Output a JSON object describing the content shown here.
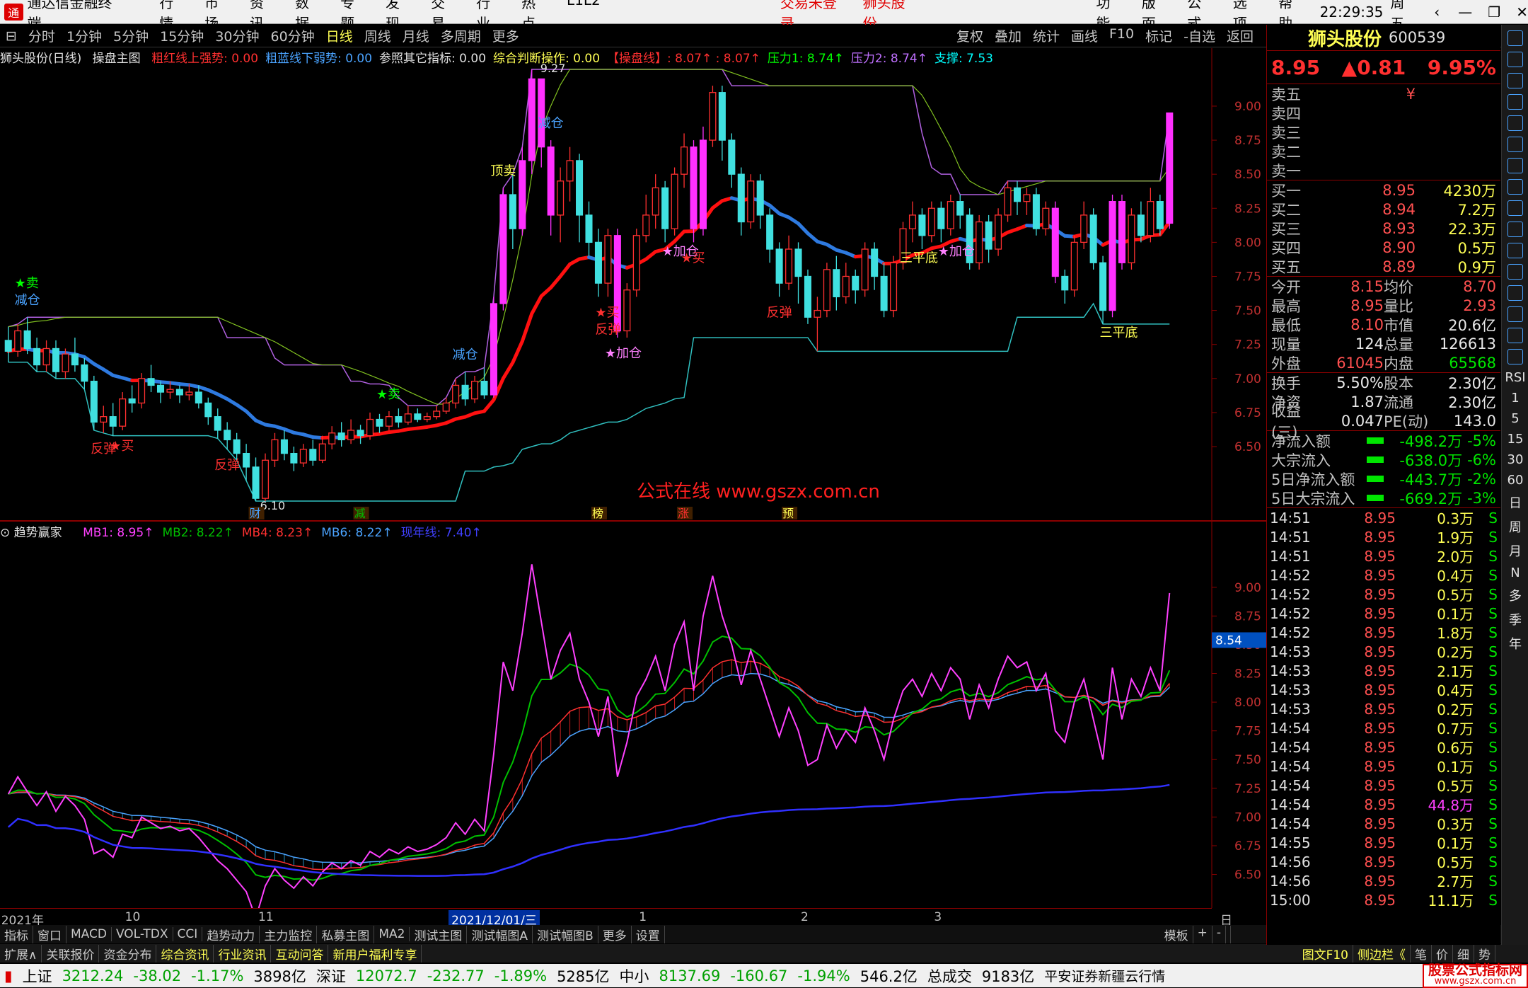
{
  "menubar": {
    "app_title": "通达信金融终端",
    "items": [
      "行情",
      "市场",
      "资讯",
      "数据",
      "专题",
      "发现",
      "交易",
      "行业",
      "热点",
      "L1L2"
    ],
    "login_status": "交易未登录",
    "stock_title": "狮头股份",
    "right_items": [
      "功能",
      "版面",
      "公式",
      "选项",
      "帮助"
    ],
    "time": "22:29:35",
    "weekday": "周五"
  },
  "toolbar": {
    "periods": [
      "分时",
      "1分钟",
      "5分钟",
      "15分钟",
      "30分钟",
      "60分钟",
      "日线",
      "周线",
      "月线",
      "多周期",
      "更多"
    ],
    "active_period": "日线",
    "right_tools": [
      "复权",
      "叠加",
      "统计",
      "画线",
      "F10",
      "标记",
      "-自选",
      "返回"
    ]
  },
  "upper_indicator": {
    "chart_label": "狮头股份(日线)",
    "main_name": "操盘主图",
    "items": [
      {
        "text": "粗红线上强势: 0.00",
        "color": "#ff3030"
      },
      {
        "text": "粗蓝线下弱势: 0.00",
        "color": "#4aa3ff"
      },
      {
        "text": "参照其它指标: 0.00",
        "color": "#e0e0e0"
      },
      {
        "text": "综合判断操作: 0.00",
        "color": "#ffff54"
      },
      {
        "text": "【操盘线】: 8.07↑ : 8.07↑",
        "color": "#ff3030"
      },
      {
        "text": "压力1: 8.74↑",
        "color": "#00ff00"
      },
      {
        "text": "压力2: 8.74↑",
        "color": "#c070ff"
      },
      {
        "text": "支撑: 7.53",
        "color": "#00ffff"
      }
    ]
  },
  "lower_indicator": {
    "name": "趋势赢家",
    "items": [
      {
        "text": "MB1: 8.95↑",
        "color": "#ff40ff"
      },
      {
        "text": "MB2: 8.22↑",
        "color": "#00c000"
      },
      {
        "text": "MB4: 8.23↑",
        "color": "#ff3030"
      },
      {
        "text": "MB6: 8.22↑",
        "color": "#4aa3ff"
      },
      {
        "text": "现年线: 7.40↑",
        "color": "#4040ff"
      }
    ],
    "current_value_tag": "8.54"
  },
  "upper_y_ticks": [
    "9.00",
    "8.75",
    "8.50",
    "8.25",
    "8.00",
    "7.75",
    "7.50",
    "7.25",
    "7.00",
    "6.75",
    "6.50"
  ],
  "lower_y_ticks": [
    "9.00",
    "8.75",
    "8.50",
    "8.25",
    "8.00",
    "7.75",
    "7.50",
    "7.25",
    "7.00",
    "6.75",
    "6.50"
  ],
  "chart_labels": {
    "high_price": "9.27",
    "low_price": "6.10",
    "watermark": "公式在线 www.gszx.com.cn",
    "signals": [
      {
        "text": "减仓",
        "color": "#4aa3ff",
        "i": 2
      },
      {
        "text": "★卖",
        "color": "#00ff00",
        "i": 2
      },
      {
        "text": "反弹",
        "color": "#ff3030",
        "i": 10
      },
      {
        "text": "★买",
        "color": "#ff3030",
        "i": 12
      },
      {
        "text": "反弹",
        "color": "#ff3030",
        "i": 23
      },
      {
        "text": "★卖",
        "color": "#00ff00",
        "i": 40
      },
      {
        "text": "减仓",
        "color": "#4aa3ff",
        "i": 48
      },
      {
        "text": "顶卖",
        "color": "#ffff54",
        "i": 52
      },
      {
        "text": "减仓",
        "color": "#4aa3ff",
        "i": 57
      },
      {
        "text": "★买",
        "color": "#ff3030",
        "i": 63
      },
      {
        "text": "反弹",
        "color": "#ff3030",
        "i": 63
      },
      {
        "text": "★加仓",
        "color": "#ff80ff",
        "i": 64
      },
      {
        "text": "★加仓",
        "color": "#ff80ff",
        "i": 70
      },
      {
        "text": "★买",
        "color": "#ff3030",
        "i": 72
      },
      {
        "text": "反弹",
        "color": "#ff3030",
        "i": 81
      },
      {
        "text": "三平底",
        "color": "#ffff54",
        "i": 95
      },
      {
        "text": "★加仓",
        "color": "#ff80ff",
        "i": 99
      },
      {
        "text": "三平底",
        "color": "#ffff54",
        "i": 116
      }
    ],
    "event_tags": [
      {
        "text": "财",
        "color": "#4aa3ff",
        "i": 26
      },
      {
        "text": "减",
        "color": "#00c000",
        "i": 37
      },
      {
        "text": "榜",
        "color": "#ffff54",
        "i": 62
      },
      {
        "text": "涨",
        "color": "#ff3030",
        "i": 71
      },
      {
        "text": "预",
        "color": "#ffff54",
        "i": 82
      }
    ]
  },
  "date_axis": {
    "labels": [
      {
        "text": "2021年",
        "i": 0
      },
      {
        "text": "10",
        "i": 13
      },
      {
        "text": "11",
        "i": 27
      },
      {
        "text": "2021/12/01/三",
        "i": 47
      },
      {
        "text": "1",
        "i": 67
      },
      {
        "text": "2",
        "i": 84
      },
      {
        "text": "3",
        "i": 98
      }
    ],
    "period_label": "日线"
  },
  "bottom_tabs": [
    "指标",
    "窗口",
    "MACD",
    "VOL-TDX",
    "CCI",
    "趋势动力",
    "主力监控",
    "私募主图",
    "MA2",
    "测试主图",
    "测试幅图A",
    "测试幅图B",
    "更多",
    "设置"
  ],
  "bottom_right": [
    "模板",
    "+",
    "-"
  ],
  "ext_bar": {
    "items": [
      "扩展∧",
      "关联报价",
      "资金分布",
      "综合资讯",
      "行业资讯",
      "互动问答",
      "新用户福利专享"
    ],
    "highlight": [
      "综合资讯",
      "行业资讯",
      "互动问答",
      "新用户福利专享"
    ],
    "right_items": [
      "图文F10",
      "侧边栏《",
      "笔",
      "价",
      "细",
      "势"
    ]
  },
  "status_bar": {
    "items": [
      {
        "name": "上证",
        "value": "3212.24",
        "change": "-38.02",
        "pct": "-1.17%",
        "amount": "3898亿"
      },
      {
        "name": "深证",
        "value": "12072.7",
        "change": "-232.77",
        "pct": "-1.89%",
        "amount": "5285亿"
      },
      {
        "name": "中小",
        "value": "8137.69",
        "change": "-160.67",
        "pct": "-1.94%",
        "amount": "546.2亿"
      }
    ],
    "total_label": "总成交",
    "total_value": "9183亿",
    "broker": "平安证券新疆云行情",
    "brand": "股票公式指标网",
    "brand_url": "www.gszx.com.cn"
  },
  "quote_panel": {
    "name": "狮头股份",
    "code": "600539",
    "price": "8.95",
    "change": "▲0.81",
    "pct": "9.95%",
    "sells": [
      {
        "label": "卖五",
        "price": "¥",
        "vol": ""
      },
      {
        "label": "卖四",
        "price": "",
        "vol": ""
      },
      {
        "label": "卖三",
        "price": "",
        "vol": ""
      },
      {
        "label": "卖二",
        "price": "",
        "vol": ""
      },
      {
        "label": "卖一",
        "price": "",
        "vol": ""
      }
    ],
    "buys": [
      {
        "label": "买一",
        "price": "8.95",
        "vol": "4230万"
      },
      {
        "label": "买二",
        "price": "8.94",
        "vol": "7.2万"
      },
      {
        "label": "买三",
        "price": "8.93",
        "vol": "22.3万"
      },
      {
        "label": "买四",
        "price": "8.90",
        "vol": "0.5万"
      },
      {
        "label": "买五",
        "price": "8.89",
        "vol": "0.9万"
      }
    ],
    "stats": [
      [
        {
          "k": "今开",
          "v": "8.15",
          "c": "r"
        },
        {
          "k": "均价",
          "v": "8.70",
          "c": "r"
        }
      ],
      [
        {
          "k": "最高",
          "v": "8.95",
          "c": "r"
        },
        {
          "k": "量比",
          "v": "2.93",
          "c": "r"
        }
      ],
      [
        {
          "k": "最低",
          "v": "8.10",
          "c": "r"
        },
        {
          "k": "市值",
          "v": "20.6亿",
          "c": "w"
        }
      ],
      [
        {
          "k": "现量",
          "v": "124",
          "c": "w"
        },
        {
          "k": "总量",
          "v": "126613",
          "c": "w"
        }
      ],
      [
        {
          "k": "外盘",
          "v": "61045",
          "c": "r"
        },
        {
          "k": "内盘",
          "v": "65568",
          "c": "g"
        }
      ]
    ],
    "fin": [
      [
        {
          "k": "换手",
          "v": "5.50%",
          "c": "w"
        },
        {
          "k": "股本",
          "v": "2.30亿",
          "c": "w"
        }
      ],
      [
        {
          "k": "净资",
          "v": "1.87",
          "c": "w"
        },
        {
          "k": "流通",
          "v": "2.30亿",
          "c": "w"
        }
      ],
      [
        {
          "k": "收益(三)",
          "v": "0.047",
          "c": "w"
        },
        {
          "k": "PE(动)",
          "v": "143.0",
          "c": "w"
        }
      ]
    ],
    "flows": [
      {
        "k": "净流入额",
        "v": "-498.2万",
        "p": "-5%"
      },
      {
        "k": "大宗流入",
        "v": "-638.0万",
        "p": "-6%"
      },
      {
        "k": "5日净流入额",
        "v": "-443.7万",
        "p": "-2%"
      },
      {
        "k": "5日大宗流入",
        "v": "-669.2万",
        "p": "-3%"
      }
    ],
    "ticks": [
      {
        "t": "14:51",
        "p": "8.95",
        "v": "0.3万",
        "s": "S"
      },
      {
        "t": "14:51",
        "p": "8.95",
        "v": "1.9万",
        "s": "S"
      },
      {
        "t": "14:51",
        "p": "8.95",
        "v": "2.0万",
        "s": "S"
      },
      {
        "t": "14:52",
        "p": "8.95",
        "v": "0.4万",
        "s": "S"
      },
      {
        "t": "14:52",
        "p": "8.95",
        "v": "0.5万",
        "s": "S"
      },
      {
        "t": "14:52",
        "p": "8.95",
        "v": "0.1万",
        "s": "S"
      },
      {
        "t": "14:52",
        "p": "8.95",
        "v": "1.8万",
        "s": "S"
      },
      {
        "t": "14:53",
        "p": "8.95",
        "v": "0.2万",
        "s": "S"
      },
      {
        "t": "14:53",
        "p": "8.95",
        "v": "2.1万",
        "s": "S"
      },
      {
        "t": "14:53",
        "p": "8.95",
        "v": "0.4万",
        "s": "S"
      },
      {
        "t": "14:53",
        "p": "8.95",
        "v": "0.2万",
        "s": "S"
      },
      {
        "t": "14:54",
        "p": "8.95",
        "v": "0.7万",
        "s": "S"
      },
      {
        "t": "14:54",
        "p": "8.95",
        "v": "0.6万",
        "s": "S"
      },
      {
        "t": "14:54",
        "p": "8.95",
        "v": "0.1万",
        "s": "S"
      },
      {
        "t": "14:54",
        "p": "8.95",
        "v": "0.5万",
        "s": "S"
      },
      {
        "t": "14:54",
        "p": "8.95",
        "v": "44.8万",
        "s": "S",
        "big": true
      },
      {
        "t": "14:54",
        "p": "8.95",
        "v": "0.3万",
        "s": "S"
      },
      {
        "t": "14:55",
        "p": "8.95",
        "v": "0.1万",
        "s": "S"
      },
      {
        "t": "14:56",
        "p": "8.95",
        "v": "0.5万",
        "s": "S"
      },
      {
        "t": "14:56",
        "p": "8.95",
        "v": "2.7万",
        "s": "S"
      },
      {
        "t": "15:00",
        "p": "8.95",
        "v": "11.1万",
        "s": "S"
      }
    ]
  },
  "side_icons": {
    "text_items": [
      "RSI",
      "1",
      "5",
      "15",
      "30",
      "60",
      "日",
      "周",
      "月",
      "N",
      "多",
      "季",
      "年"
    ]
  },
  "chart_data": {
    "type": "candlestick",
    "candles": [
      [
        7.28,
        7.2,
        7.38,
        7.12
      ],
      [
        7.2,
        7.35,
        7.4,
        7.16
      ],
      [
        7.35,
        7.22,
        7.45,
        7.18
      ],
      [
        7.22,
        7.1,
        7.3,
        7.05
      ],
      [
        7.1,
        7.22,
        7.28,
        7.05
      ],
      [
        7.22,
        7.05,
        7.28,
        7.0
      ],
      [
        7.05,
        7.18,
        7.22,
        7.0
      ],
      [
        7.18,
        7.1,
        7.3,
        7.05
      ],
      [
        7.1,
        6.98,
        7.15,
        6.92
      ],
      [
        6.98,
        6.68,
        7.02,
        6.62
      ],
      [
        6.68,
        6.72,
        6.8,
        6.6
      ],
      [
        6.72,
        6.65,
        6.82,
        6.58
      ],
      [
        6.65,
        6.85,
        6.9,
        6.62
      ],
      [
        6.85,
        6.82,
        6.95,
        6.75
      ],
      [
        6.82,
        7.0,
        7.04,
        6.78
      ],
      [
        7.0,
        6.95,
        7.1,
        6.9
      ],
      [
        6.95,
        6.9,
        6.98,
        6.82
      ],
      [
        6.9,
        6.92,
        6.98,
        6.85
      ],
      [
        6.92,
        6.88,
        6.95,
        6.82
      ],
      [
        6.88,
        6.9,
        6.96,
        6.84
      ],
      [
        6.9,
        6.82,
        6.95,
        6.78
      ],
      [
        6.82,
        6.72,
        6.86,
        6.66
      ],
      [
        6.72,
        6.62,
        6.78,
        6.56
      ],
      [
        6.62,
        6.55,
        6.68,
        6.48
      ],
      [
        6.55,
        6.45,
        6.6,
        6.4
      ],
      [
        6.45,
        6.35,
        6.52,
        6.25
      ],
      [
        6.35,
        6.12,
        6.42,
        6.1
      ],
      [
        6.12,
        6.4,
        6.45,
        6.1
      ],
      [
        6.4,
        6.55,
        6.6,
        6.35
      ],
      [
        6.55,
        6.45,
        6.62,
        6.4
      ],
      [
        6.45,
        6.38,
        6.5,
        6.32
      ],
      [
        6.38,
        6.48,
        6.52,
        6.35
      ],
      [
        6.48,
        6.4,
        6.55,
        6.36
      ],
      [
        6.4,
        6.52,
        6.58,
        6.38
      ],
      [
        6.52,
        6.6,
        6.65,
        6.48
      ],
      [
        6.6,
        6.55,
        6.68,
        6.5
      ],
      [
        6.55,
        6.62,
        6.7,
        6.52
      ],
      [
        6.62,
        6.58,
        6.66,
        6.52
      ],
      [
        6.58,
        6.7,
        6.75,
        6.55
      ],
      [
        6.7,
        6.65,
        6.74,
        6.6
      ],
      [
        6.65,
        6.72,
        6.76,
        6.62
      ],
      [
        6.72,
        6.68,
        6.78,
        6.64
      ],
      [
        6.68,
        6.74,
        6.8,
        6.66
      ],
      [
        6.74,
        6.7,
        6.78,
        6.68
      ],
      [
        6.7,
        6.72,
        6.75,
        6.68
      ],
      [
        6.72,
        6.76,
        6.8,
        6.7
      ],
      [
        6.76,
        6.82,
        6.86,
        6.74
      ],
      [
        6.82,
        6.95,
        7.0,
        6.78
      ],
      [
        6.95,
        6.85,
        7.05,
        6.8
      ],
      [
        6.85,
        6.98,
        7.02,
        6.82
      ],
      [
        6.98,
        6.88,
        7.08,
        6.85
      ],
      [
        6.88,
        7.55,
        7.6,
        6.86
      ],
      [
        7.55,
        8.35,
        8.4,
        7.5
      ],
      [
        8.35,
        8.1,
        8.5,
        7.95
      ],
      [
        8.1,
        8.6,
        8.7,
        8.05
      ],
      [
        8.6,
        9.2,
        9.27,
        8.5
      ],
      [
        9.2,
        8.7,
        9.05,
        8.55
      ],
      [
        8.7,
        8.2,
        8.75,
        8.05
      ],
      [
        8.2,
        8.45,
        8.55,
        8.0
      ],
      [
        8.45,
        8.6,
        8.7,
        8.3
      ],
      [
        8.6,
        8.2,
        8.65,
        8.0
      ],
      [
        8.2,
        8.0,
        8.3,
        7.9
      ],
      [
        8.0,
        7.7,
        8.1,
        7.6
      ],
      [
        7.7,
        8.05,
        8.1,
        7.6
      ],
      [
        8.05,
        7.35,
        8.1,
        7.3
      ],
      [
        7.35,
        7.65,
        7.7,
        7.3
      ],
      [
        7.65,
        8.05,
        8.1,
        7.6
      ],
      [
        8.05,
        8.2,
        8.35,
        8.0
      ],
      [
        8.2,
        8.4,
        8.5,
        8.1
      ],
      [
        8.4,
        8.1,
        8.45,
        8.0
      ],
      [
        8.1,
        8.5,
        8.55,
        8.05
      ],
      [
        8.5,
        8.7,
        8.8,
        8.4
      ],
      [
        8.7,
        8.1,
        8.75,
        8.0
      ],
      [
        8.1,
        8.75,
        8.85,
        8.05
      ],
      [
        8.75,
        9.1,
        9.15,
        8.7
      ],
      [
        9.1,
        8.75,
        9.15,
        8.6
      ],
      [
        8.75,
        8.5,
        8.8,
        8.4
      ],
      [
        8.5,
        8.15,
        8.55,
        8.05
      ],
      [
        8.15,
        8.45,
        8.5,
        8.1
      ],
      [
        8.45,
        8.2,
        8.5,
        8.1
      ],
      [
        8.2,
        7.95,
        8.25,
        7.85
      ],
      [
        7.95,
        7.7,
        8.0,
        7.6
      ],
      [
        7.7,
        7.95,
        8.05,
        7.65
      ],
      [
        7.95,
        7.75,
        8.0,
        7.55
      ],
      [
        7.75,
        7.45,
        7.8,
        7.4
      ],
      [
        7.45,
        7.5,
        7.6,
        7.2
      ],
      [
        7.5,
        7.8,
        7.85,
        7.45
      ],
      [
        7.8,
        7.6,
        7.9,
        7.5
      ],
      [
        7.6,
        7.75,
        7.85,
        7.55
      ],
      [
        7.75,
        7.65,
        7.8,
        7.55
      ],
      [
        7.65,
        7.95,
        8.0,
        7.6
      ],
      [
        7.95,
        7.75,
        8.0,
        7.65
      ],
      [
        7.75,
        7.5,
        7.85,
        7.45
      ],
      [
        7.5,
        7.85,
        7.9,
        7.45
      ],
      [
        7.85,
        8.1,
        8.15,
        7.8
      ],
      [
        8.1,
        8.2,
        8.3,
        8.0
      ],
      [
        8.2,
        8.05,
        8.25,
        7.95
      ],
      [
        8.05,
        8.25,
        8.3,
        8.0
      ],
      [
        8.25,
        8.1,
        8.3,
        8.0
      ],
      [
        8.1,
        8.3,
        8.35,
        8.05
      ],
      [
        8.3,
        8.2,
        8.35,
        8.1
      ],
      [
        8.2,
        7.85,
        8.25,
        7.8
      ],
      [
        7.85,
        8.15,
        8.2,
        7.8
      ],
      [
        8.15,
        7.95,
        8.2,
        7.85
      ],
      [
        7.95,
        8.2,
        8.25,
        7.9
      ],
      [
        8.2,
        8.4,
        8.45,
        8.15
      ],
      [
        8.4,
        8.3,
        8.45,
        8.2
      ],
      [
        8.3,
        8.35,
        8.4,
        8.2
      ],
      [
        8.35,
        8.1,
        8.4,
        8.05
      ],
      [
        8.1,
        8.25,
        8.3,
        8.05
      ],
      [
        8.25,
        7.75,
        8.3,
        7.7
      ],
      [
        7.75,
        7.65,
        7.8,
        7.55
      ],
      [
        7.65,
        8.0,
        8.05,
        7.6
      ],
      [
        8.0,
        8.2,
        8.3,
        7.95
      ],
      [
        8.2,
        7.85,
        8.25,
        7.8
      ],
      [
        7.85,
        7.5,
        7.9,
        7.4
      ],
      [
        7.5,
        8.3,
        8.35,
        7.45
      ],
      [
        8.3,
        7.85,
        8.35,
        7.8
      ],
      [
        7.85,
        8.2,
        8.25,
        7.8
      ],
      [
        8.2,
        8.05,
        8.3,
        8.0
      ],
      [
        8.05,
        8.3,
        8.4,
        8.0
      ],
      [
        8.3,
        8.1,
        8.35,
        8.05
      ],
      [
        8.14,
        8.95,
        8.95,
        8.1
      ]
    ],
    "upper_ylim": [
      6.1,
      9.27
    ],
    "lower_ylim": [
      6.3,
      9.35
    ]
  }
}
